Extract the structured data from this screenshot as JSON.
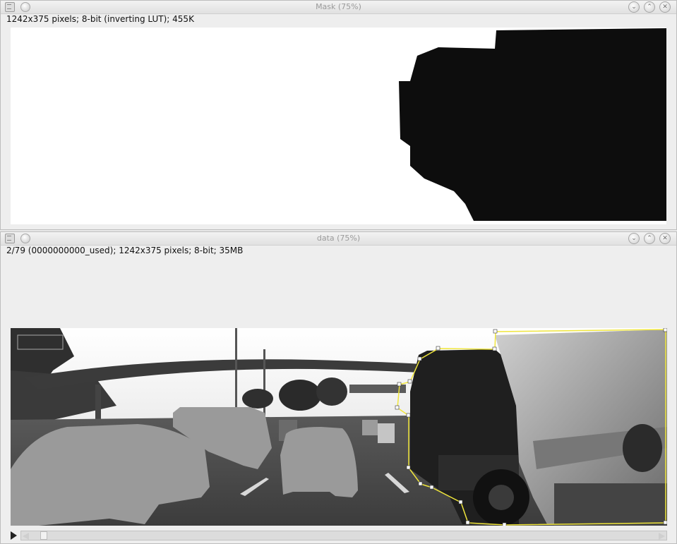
{
  "mask_window": {
    "title": "Mask (75%)",
    "info": "1242x375 pixels; 8-bit (inverting LUT); 455K",
    "buttons": {
      "minimize": "⌄",
      "maximize": "⌃",
      "close": "✕"
    }
  },
  "data_window": {
    "title": "data (75%)",
    "info": "2/79 (0000000000_used); 1242x375 pixels; 8-bit; 35MB",
    "buttons": {
      "minimize": "⌄",
      "maximize": "⌃",
      "close": "✕"
    },
    "stack": {
      "current_slice": 2,
      "total_slices": 79
    }
  },
  "colors": {
    "roi_outline": "#f0e63c",
    "mask_foreground": "#0d0d0d",
    "mask_background": "#ffffff",
    "window_background": "#eeeeee"
  },
  "icons": {
    "window_menu": "window-menu-icon",
    "play": "play-icon",
    "scroll_left": "arrow-left-icon",
    "scroll_right": "arrow-right-icon"
  }
}
